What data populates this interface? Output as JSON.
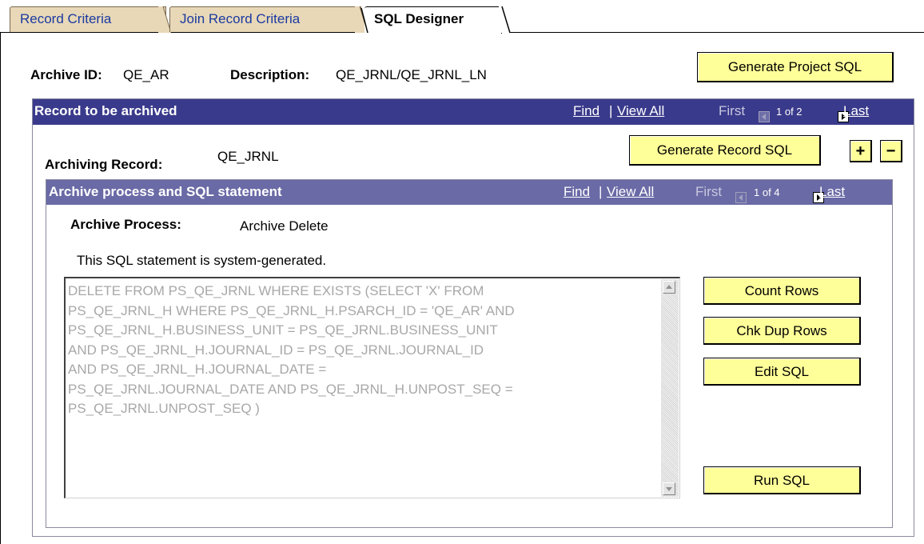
{
  "tabs": [
    {
      "label": "Record Criteria",
      "active": false
    },
    {
      "label": "Join Record Criteria",
      "active": false
    },
    {
      "label": "SQL Designer",
      "active": true
    }
  ],
  "header": {
    "archive_id_label": "Archive ID:",
    "archive_id_value": "QE_AR",
    "description_label": "Description:",
    "description_value": "QE_JRNL/QE_JRNL_LN",
    "generate_project_sql": "Generate Project SQL"
  },
  "record_grid": {
    "title": "Record to be archived",
    "find": "Find",
    "separator": "|",
    "view_all": "View All",
    "first": "First",
    "position": "1 of 2",
    "last": "Last",
    "archiving_record_label": "Archiving Record:",
    "archiving_record_value": "QE_JRNL",
    "generate_record_sql": "Generate Record SQL",
    "add_row": "+",
    "delete_row": "−"
  },
  "process_grid": {
    "title": "Archive process and SQL statement",
    "find": "Find",
    "separator": "|",
    "view_all": "View All",
    "first": "First",
    "position": "1 of 4",
    "last": "Last",
    "archive_process_label": "Archive Process:",
    "archive_process_value": "Archive Delete",
    "system_generated_note": "This SQL statement is system-generated.",
    "sql_statement": "DELETE FROM PS_QE_JRNL WHERE EXISTS (SELECT 'X' FROM\nPS_QE_JRNL_H WHERE PS_QE_JRNL_H.PSARCH_ID = 'QE_AR' AND\nPS_QE_JRNL_H.BUSINESS_UNIT = PS_QE_JRNL.BUSINESS_UNIT\nAND PS_QE_JRNL_H.JOURNAL_ID = PS_QE_JRNL.JOURNAL_ID\nAND PS_QE_JRNL_H.JOURNAL_DATE =\nPS_QE_JRNL.JOURNAL_DATE  AND PS_QE_JRNL_H.UNPOST_SEQ =\nPS_QE_JRNL.UNPOST_SEQ )",
    "buttons": {
      "count_rows": "Count Rows",
      "chk_dup_rows": "Chk Dup Rows",
      "edit_sql": "Edit SQL",
      "run_sql": "Run SQL"
    }
  },
  "colors": {
    "tab_inactive": "#e8d8b8",
    "button_yellow": "#ffff99",
    "grid_header_dark": "#3a3a8c",
    "grid_header_light": "#6a6aa6",
    "link_blue": "#1a3aa0",
    "disabled_text": "#a8a8a8"
  }
}
